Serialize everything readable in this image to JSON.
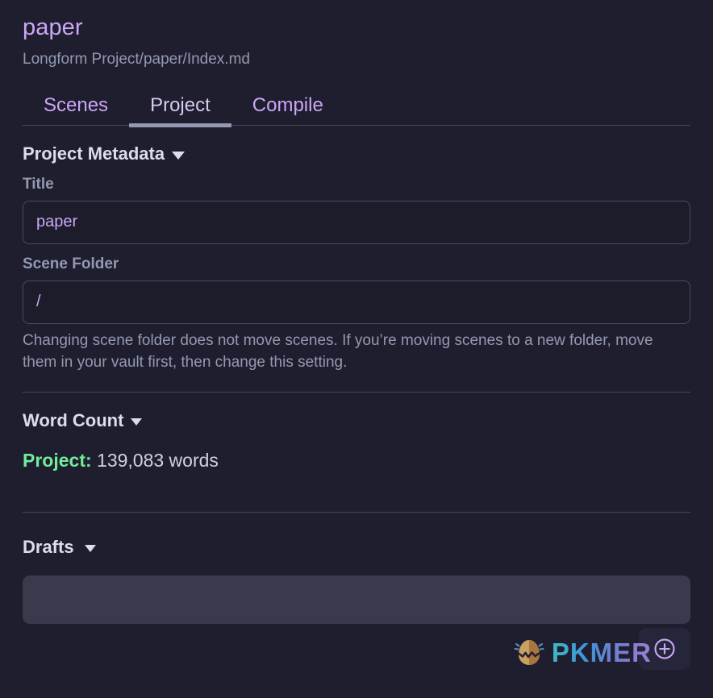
{
  "header": {
    "title": "paper",
    "subtitle": "Longform Project/paper/Index.md"
  },
  "tabs": [
    {
      "label": "Scenes",
      "active": false
    },
    {
      "label": "Project",
      "active": true
    },
    {
      "label": "Compile",
      "active": false
    }
  ],
  "project_metadata": {
    "section_title": "Project Metadata",
    "title_label": "Title",
    "title_value": "paper",
    "scene_folder_label": "Scene Folder",
    "scene_folder_value": "/",
    "scene_folder_help": "Changing scene folder does not move scenes. If you’re moving scenes to a new folder, move them in your vault first, then change this setting."
  },
  "word_count": {
    "section_title": "Word Count",
    "scope_label": "Project:",
    "value_text": "139,083 words"
  },
  "drafts": {
    "section_title": "Drafts",
    "add_button_label": "+"
  },
  "watermark": {
    "text": "PKMER"
  },
  "colors": {
    "background": "#1e1e2e",
    "accent_purple": "#cba6f7",
    "muted_text": "#9399b2",
    "bright_text": "#dcdcf0",
    "green": "#73eb9a",
    "border": "#45475a",
    "input_border": "#4a4b5e",
    "draft_item_bg": "#393a4b"
  }
}
